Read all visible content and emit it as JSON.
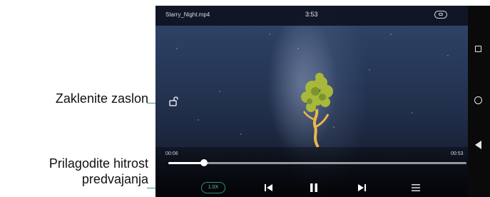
{
  "video": {
    "file_name": "Starry_Night.mp4",
    "clock": "3:53",
    "elapsed": "00:06",
    "duration": "00:53",
    "progress_fraction": 0.12,
    "speed_label": "1.0X"
  },
  "callouts": {
    "lock_screen": "Zaklenite zaslon",
    "playback_speed_line1": "Prilagodite hitrost",
    "playback_speed_line2": "predvajanja"
  },
  "icons": {
    "lock": "unlock-icon",
    "previous": "skip-previous-icon",
    "pause": "pause-icon",
    "next": "skip-next-icon",
    "menu": "menu-icon",
    "mini_window": "floating-window-icon",
    "nav_square": "recent-apps-icon",
    "nav_circle": "home-icon",
    "nav_back": "back-icon"
  },
  "colors": {
    "accent": "#2aa37a",
    "speed_text": "#5fc393"
  }
}
